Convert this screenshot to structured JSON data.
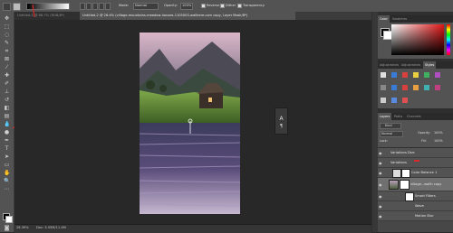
{
  "options_bar": {
    "mode_label": "Mode:",
    "mode_value": "Normal",
    "opacity_label": "Opacity:",
    "opacity_value": "100%",
    "reverse_label": "Reverse",
    "dither_label": "Dither",
    "transparency_label": "Transparency"
  },
  "tabs": [
    {
      "label": "Untitled-1 @ 66.7% (RGB/8*)"
    },
    {
      "label": "Untitled-2 @ 26.4% (village-mountains-meadow-houses-1105003-wallhere.com copy, Layer Mask/8*)"
    }
  ],
  "status": {
    "zoom": "26.39%",
    "doc": "Doc: 3.55M/11.4M"
  },
  "float_panel": {
    "glyph": "A"
  },
  "right_panels": {
    "color_tabs": [
      "Color",
      "Swatches"
    ],
    "adjust_tabs": [
      "Adjustments",
      "Adjustments",
      "Styles"
    ],
    "layer_tabs": [
      "Layers",
      "Paths",
      "Channels"
    ],
    "kind_label": "Kind",
    "blend_value": "Normal",
    "opacity_label": "Opacity:",
    "opacity_value": "100%",
    "fill_label": "Fill:",
    "fill_value": "100%",
    "lock_label": "Lock:",
    "layers": [
      {
        "name": "Variations Dsrc"
      },
      {
        "name": "Variations"
      },
      {
        "name": "Color Balance 1"
      },
      {
        "name": "village...wallh copy"
      },
      {
        "name": "Smart Filters"
      },
      {
        "name": "Wave"
      },
      {
        "name": "Motion Blur"
      }
    ]
  },
  "colors": {
    "accent_red": "#d42a2a",
    "panel": "#535353",
    "dark": "#282828"
  }
}
